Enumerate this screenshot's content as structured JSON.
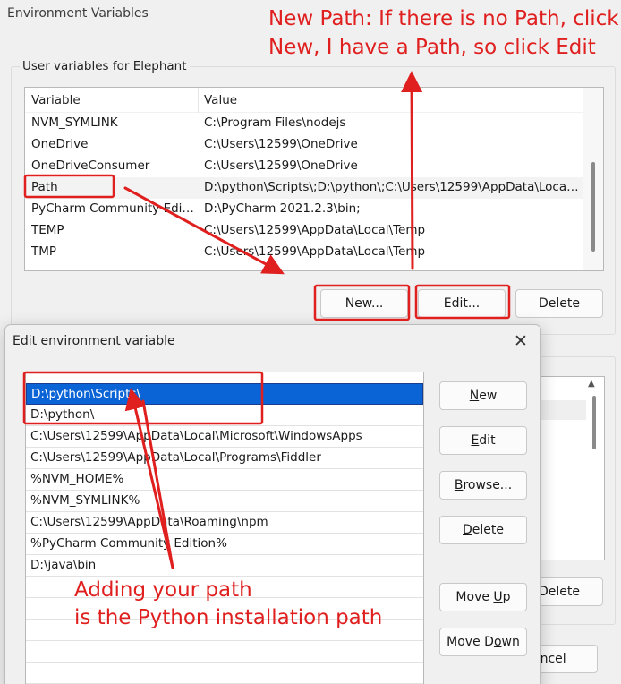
{
  "outer": {
    "title": "Environment Variables",
    "user_group_label": "User variables for Elephant",
    "columns": {
      "variable": "Variable",
      "value": "Value"
    },
    "rows": [
      {
        "variable": "NVM_SYMLINK",
        "value": "C:\\Program Files\\nodejs"
      },
      {
        "variable": "OneDrive",
        "value": "C:\\Users\\12599\\OneDrive"
      },
      {
        "variable": "OneDriveConsumer",
        "value": "C:\\Users\\12599\\OneDrive"
      },
      {
        "variable": "Path",
        "value": "D:\\python\\Scripts\\;D:\\python\\;C:\\Users\\12599\\AppData\\Local..."
      },
      {
        "variable": "PyCharm Community Editi...",
        "value": "D:\\PyCharm 2021.2.3\\bin;"
      },
      {
        "variable": "TEMP",
        "value": "C:\\Users\\12599\\AppData\\Local\\Temp"
      },
      {
        "variable": "TMP",
        "value": "C:\\Users\\12599\\AppData\\Local\\Temp"
      }
    ],
    "buttons": {
      "new": "New...",
      "edit": "Edit...",
      "delete": "Delete"
    },
    "system_buttons": {
      "delete": "Delete",
      "cancel_fragment": "ancel"
    }
  },
  "edit_dialog": {
    "title": "Edit environment variable",
    "close_glyph": "✕",
    "paths": [
      "D:\\python\\Scripts\\",
      "D:\\python\\",
      "C:\\Users\\12599\\AppData\\Local\\Microsoft\\WindowsApps",
      "C:\\Users\\12599\\AppData\\Local\\Programs\\Fiddler",
      "%NVM_HOME%",
      "%NVM_SYMLINK%",
      "C:\\Users\\12599\\AppData\\Roaming\\npm",
      "%PyCharm Community Edition%",
      "D:\\java\\bin"
    ],
    "buttons": {
      "new": {
        "pre": "",
        "u": "N",
        "post": "ew"
      },
      "edit": {
        "pre": "",
        "u": "E",
        "post": "dit"
      },
      "browse": {
        "pre": "",
        "u": "B",
        "post": "rowse..."
      },
      "delete": {
        "pre": "",
        "u": "D",
        "post": "elete"
      },
      "move_up": {
        "pre": "Move ",
        "u": "U",
        "post": "p"
      },
      "move_down": {
        "pre": "Move D",
        "u": "o",
        "post": "wn"
      }
    }
  },
  "annotations": {
    "top_line1": "New Path: If there is no Path, click",
    "top_line2": "New, I have a Path, so click Edit",
    "bottom_line1": "Adding your path",
    "bottom_line2": "is the Python installation path",
    "color": "#e01f1f"
  }
}
